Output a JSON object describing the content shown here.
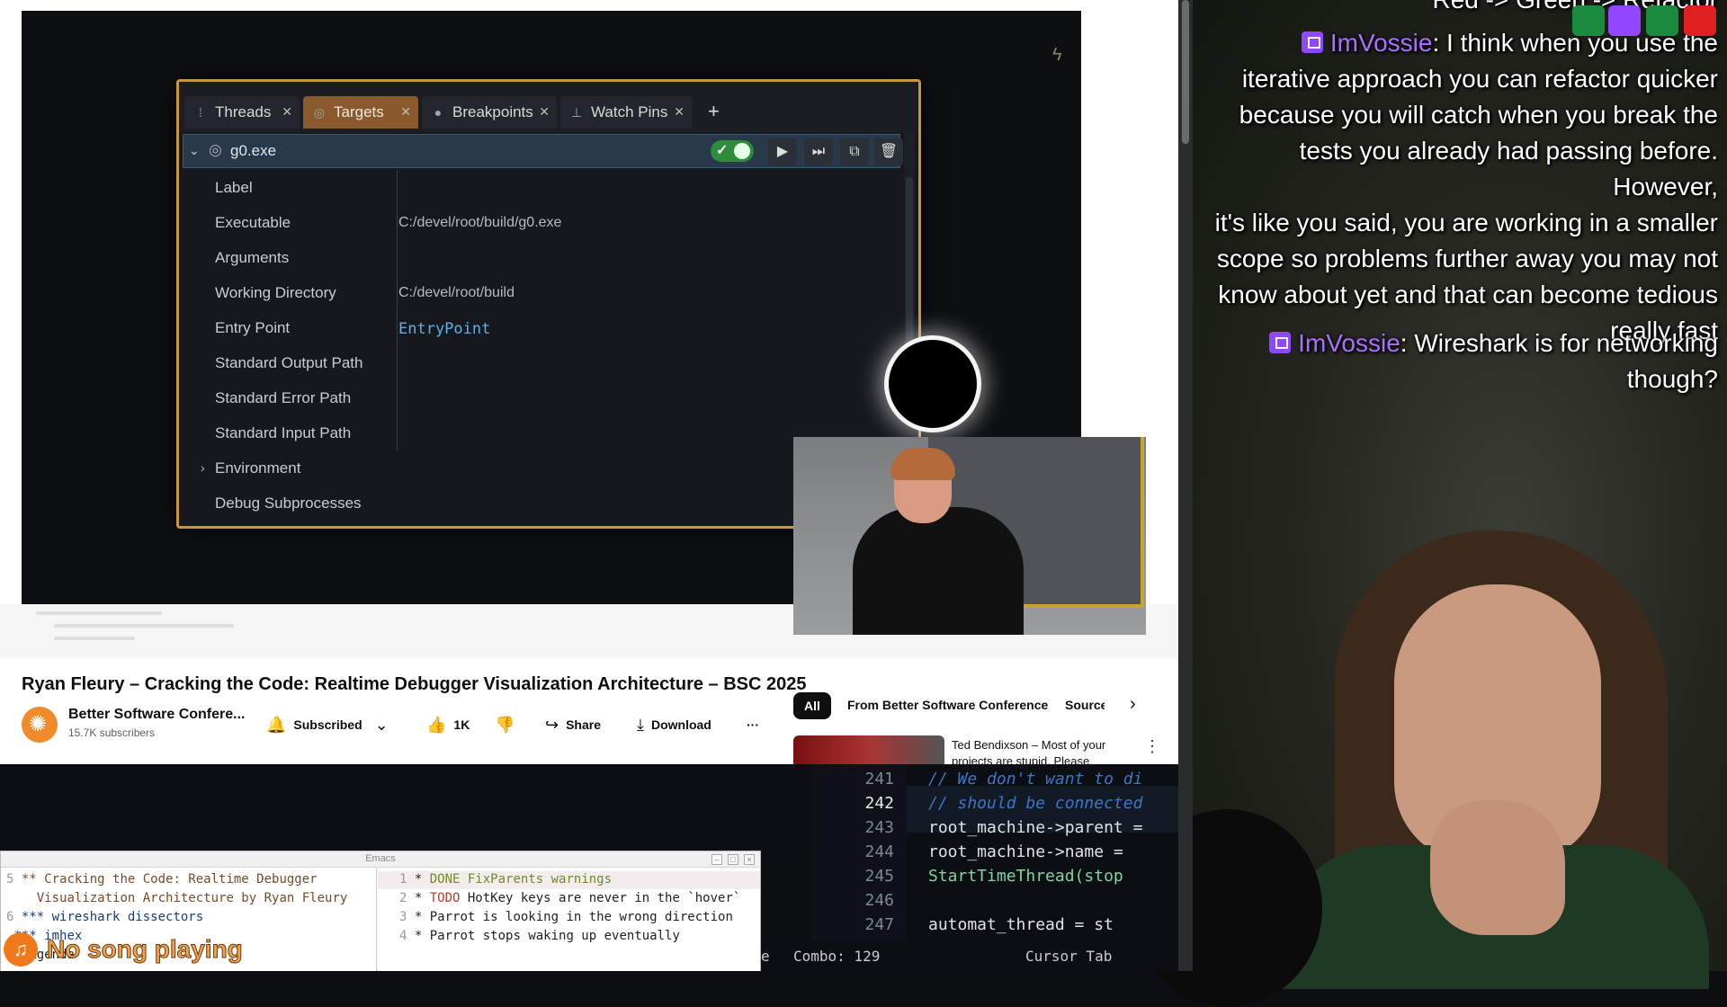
{
  "debugger": {
    "tabs": [
      {
        "label": "Threads",
        "icon": "threads-icon"
      },
      {
        "label": "Targets",
        "icon": "globe-icon"
      },
      {
        "label": "Breakpoints",
        "icon": "breakpoint-dot-icon"
      },
      {
        "label": "Watch Pins",
        "icon": "pin-icon"
      }
    ],
    "add_tab": "+",
    "target_name": "g0.exe",
    "toggle_enabled": true,
    "fields": [
      {
        "label": "Label",
        "value": ""
      },
      {
        "label": "Executable",
        "value": "C:/devel/root/build/g0.exe"
      },
      {
        "label": "Arguments",
        "value": ""
      },
      {
        "label": "Working Directory",
        "value": "C:/devel/root/build"
      },
      {
        "label": "Entry Point",
        "value": "EntryPoint"
      },
      {
        "label": "Standard Output Path",
        "value": ""
      },
      {
        "label": "Standard Error Path",
        "value": ""
      },
      {
        "label": "Standard Input Path",
        "value": ""
      },
      {
        "label": "Environment",
        "value": ""
      },
      {
        "label": "Debug Subprocesses",
        "value": ""
      }
    ]
  },
  "video": {
    "title": "Ryan Fleury – Cracking the Code: Realtime Debugger Visualization Architecture – BSC 2025",
    "channel": "Better Software Confere...",
    "subscribers": "15.7K subscribers",
    "subscribe_label": "Subscribed",
    "likes": "1K",
    "share_label": "Share",
    "download_label": "Download",
    "more_label": "···"
  },
  "recommendations": {
    "chips": [
      "All",
      "From Better Software Conference",
      "Source"
    ],
    "next_chip": "›",
    "item_title": "Ted Bendixson – Most of your projects are stupid. Please"
  },
  "chat": {
    "top_line": "Red -> Green -> Refactor",
    "messages": [
      {
        "user": "ImVossie",
        "lines": [
          "I think when you use the",
          "iterative approach you can refactor quicker",
          "because you will catch when you break the",
          "tests you already had passing before. However,",
          "it's like you said, you are working in a smaller",
          "scope so problems further away you may not",
          "know about yet and that can become tedious",
          "really fast"
        ]
      },
      {
        "user": "ImVossie",
        "lines": [
          "Wireshark is for networking",
          "though?"
        ]
      }
    ]
  },
  "code_editor": {
    "lines": [
      {
        "num": "241",
        "text": "// We don't want to di",
        "kind": "comment"
      },
      {
        "num": "242",
        "text": "// should be connected",
        "kind": "comment"
      },
      {
        "num": "243",
        "text": "root_machine->parent =",
        "kind": "code"
      },
      {
        "num": "244",
        "text": "root_machine->name =",
        "kind": "code"
      },
      {
        "num": "245",
        "text": "StartTimeThread(stop",
        "kind": "fn"
      },
      {
        "num": "246",
        "text": "",
        "kind": "code"
      },
      {
        "num": "247",
        "text": "automat_thread = st",
        "kind": "code"
      }
    ],
    "status_left": "e",
    "status_combo": "Combo: 129",
    "status_right": "Cursor Tab"
  },
  "emacs": {
    "title": "Emacs",
    "left_lines": [
      {
        "num": "5",
        "text": "** Cracking the Code: Realtime Debugger"
      },
      {
        "num": "",
        "text": "   Visualization Architecture by Ryan Fleury"
      },
      {
        "num": "6",
        "text": "*** wireshark dissectors"
      },
      {
        "num": "",
        "text": "*** imhex"
      },
      {
        "num": "",
        "text": "* Agenda"
      }
    ],
    "right_lines": [
      {
        "num": "1",
        "kw": "DONE",
        "text": " FixParents warnings"
      },
      {
        "num": "2",
        "kw": "TODO",
        "text": " HotKey keys are never in the `hover`"
      },
      {
        "num": "3",
        "kw": "",
        "text": "Parrot is looking in the wrong direction"
      },
      {
        "num": "4",
        "kw": "",
        "text": "Parrot stops waking up eventually"
      }
    ]
  },
  "now_playing": {
    "text": "No song playing",
    "icon": "music-note-icon"
  },
  "colors": {
    "accent_orange": "#c9963a",
    "twitch_purple": "#9146ff",
    "chat_name": "#a970ff"
  }
}
